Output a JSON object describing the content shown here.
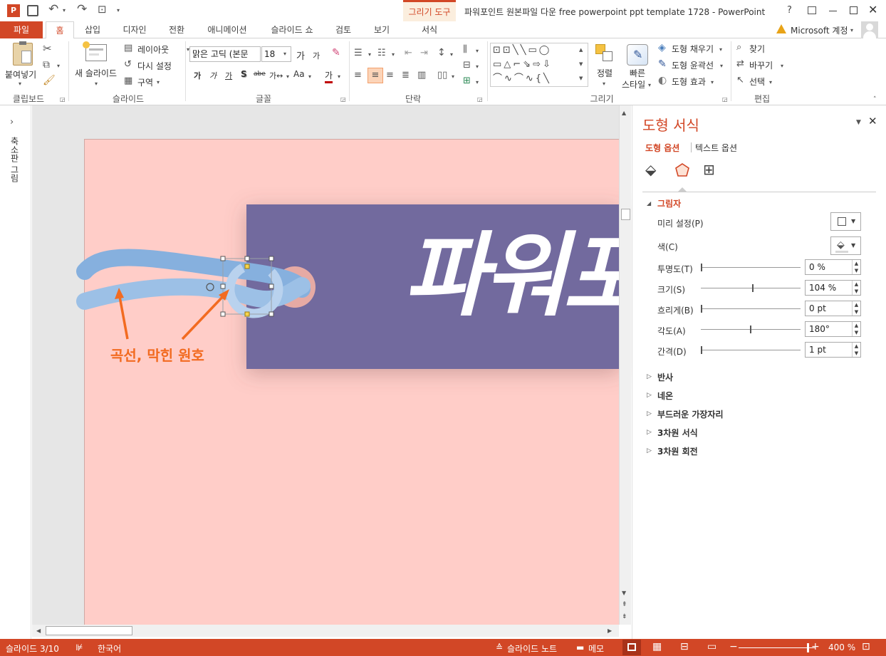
{
  "window": {
    "title": "파워포인트 원본파일 다운 free powerpoint ppt template 1728 - PowerPoint",
    "contextual_tab_group": "그리기 도구",
    "help": "?",
    "account": "Microsoft 계정"
  },
  "tabs": {
    "file": "파일",
    "home": "홈",
    "insert": "삽입",
    "design": "디자인",
    "transitions": "전환",
    "animations": "애니메이션",
    "slideshow": "슬라이드 쇼",
    "review": "검토",
    "view": "보기",
    "format": "서식"
  },
  "ribbon": {
    "clipboard": {
      "paste": "붙여넣기",
      "label": "클립보드"
    },
    "slides": {
      "new_slide": "새 슬라이드",
      "layout": "레이아웃",
      "reset": "다시 설정",
      "section": "구역",
      "label": "슬라이드"
    },
    "font": {
      "family": "맑은 고딕 (본문",
      "size": "18",
      "grow": "가",
      "shrink": "가",
      "bold": "가",
      "italic": "가",
      "underline": "가",
      "shadow": "S",
      "strike": "abe",
      "spacing": "가↔",
      "case": "Aa",
      "color": "가",
      "label": "글꼴"
    },
    "paragraph": {
      "label": "단락"
    },
    "drawing": {
      "arrange": "정렬",
      "quick_styles_1": "빠른",
      "quick_styles_2": "스타일",
      "fill": "도형 채우기",
      "outline": "도형 윤곽선",
      "effects": "도형 효과",
      "label": "그리기"
    },
    "editing": {
      "find": "찾기",
      "replace": "바꾸기",
      "select": "선택",
      "label": "편집"
    }
  },
  "left_panel": {
    "label": "축소판 그림"
  },
  "slide": {
    "title_text": "파워포",
    "annotation": "곡선, 막힌 원호",
    "bg_color": "#ffcdc8",
    "banner_color": "#726a9e",
    "curve_color": "#8fb6e1",
    "arrow_color": "#f26b21"
  },
  "pane": {
    "title": "도형 서식",
    "tab_shape": "도형 옵션",
    "tab_text": "텍스트 옵션",
    "section_shadow": "그림자",
    "presets": "미리 설정(P)",
    "color": "색(C)",
    "transparency": {
      "label": "투명도(T)",
      "value": "0 %",
      "level": 0.0
    },
    "size": {
      "label": "크기(S)",
      "value": "104 %",
      "level": 0.52
    },
    "blur": {
      "label": "흐리게(B)",
      "value": "0 pt",
      "level": 0.0
    },
    "angle": {
      "label": "각도(A)",
      "value": "180°",
      "level": 0.5
    },
    "distance": {
      "label": "간격(D)",
      "value": "1 pt",
      "level": 0.0
    },
    "sections": [
      "반사",
      "네온",
      "부드러운 가장자리",
      "3차원 서식",
      "3차원 회전"
    ]
  },
  "status": {
    "slide": "슬라이드 3/10",
    "language": "한국어",
    "notes": "슬라이드 노트",
    "comments": "메모",
    "zoom": "400 %"
  }
}
